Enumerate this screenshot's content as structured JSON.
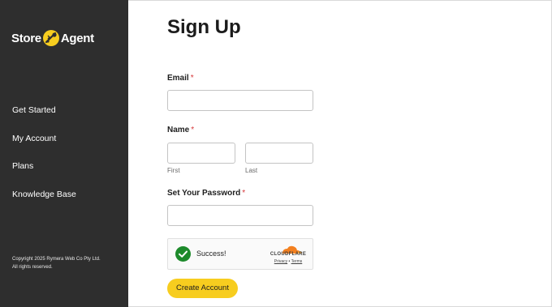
{
  "sidebar": {
    "logo": {
      "part1": "Store",
      "part2": "Agent"
    },
    "nav": [
      {
        "label": "Get Started"
      },
      {
        "label": "My Account"
      },
      {
        "label": "Plans"
      },
      {
        "label": "Knowledge Base"
      }
    ],
    "copyright_line1": "Copyright 2025 Rymera Web Co Pty Ltd.",
    "copyright_line2": "All rights reserved."
  },
  "form": {
    "title": "Sign Up",
    "email": {
      "label": "Email",
      "required_mark": "*",
      "value": ""
    },
    "name": {
      "label": "Name",
      "required_mark": "*",
      "first_value": "",
      "last_value": "",
      "first_sublabel": "First",
      "last_sublabel": "Last"
    },
    "password": {
      "label": "Set Your Password",
      "required_mark": "*",
      "value": ""
    },
    "captcha": {
      "status": "Success!",
      "brand": "CLOUDFLARE",
      "privacy": "Privacy",
      "separator": "•",
      "terms": "Terms"
    },
    "submit_label": "Create Account"
  },
  "colors": {
    "sidebar_bg": "#2e2e2e",
    "accent_yellow": "#f7cd1f",
    "required_red": "#d63638",
    "success_green": "#1d8a2b",
    "cloudflare_orange": "#f38020"
  }
}
